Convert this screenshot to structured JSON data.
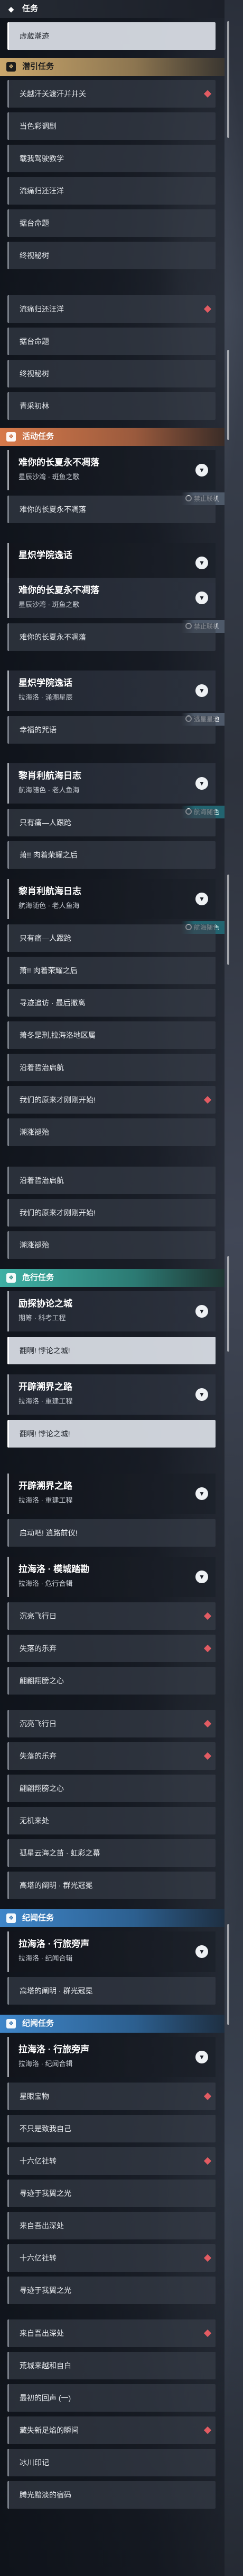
{
  "sections": {
    "task": "任务",
    "guide": "潜引任务",
    "event": "活动任务",
    "danger": "危行任务",
    "trace1": "纪闻任务",
    "trace2": "纪闻任务"
  },
  "top_items": [
    "虚葳潮迹"
  ],
  "guide_items_a": [
    "关越汗关渡汗并并关",
    "当色彩调剧",
    "载我驾驶教学",
    "流痛归还汪洋",
    "据台命题",
    "终视秘树"
  ],
  "guide_items_b": [
    "流痛归还汪洋",
    "据台命题",
    "终视秘树",
    "青采初林"
  ],
  "event": {
    "q1": {
      "title": "难你的长夏永不凋落",
      "sub": "星辰沙湾 · 斑鱼之歌",
      "items": [
        "难你的长夏永不凋落"
      ],
      "badge": "禁止联机"
    },
    "q2": {
      "title": "星炽学院逸话"
    },
    "q3": {
      "title": "难你的长夏永不凋落",
      "sub": "星辰沙湾 · 斑鱼之歌",
      "items": [
        "难你的长夏永不凋落"
      ],
      "badge": "禁止联机"
    },
    "q4": {
      "title": "星炽学院逸话",
      "sub": "拉海洛 · 涌潮星辰",
      "items": [
        "幸福的咒语"
      ],
      "badge": "逃星星池"
    },
    "q5": {
      "title": "黎肖利航海日志",
      "sub": "航海随色 · 老人鱼海",
      "items": [
        "只有痛—人跟跄",
        "萧!! 肉着荣耀之后"
      ],
      "badge": "航海随色"
    },
    "q6": {
      "title": "黎肖利航海日志",
      "sub": "航海随色 · 老人鱼海",
      "items": [
        "只有痛—人跟跄",
        "萧!! 肉着荣耀之后",
        "寻迹追访 · 最后撤离",
        "萧冬是刑,拉海洛地区属",
        "沿着哲治启航",
        "我们的原来才刚刚开始!",
        "潮涨褪殆"
      ],
      "badge": "航海随色"
    },
    "tail": [
      "沿着哲治启航",
      "我们的原来才刚刚开始!",
      "潮涨褪殆"
    ]
  },
  "danger": {
    "q1": {
      "title": "励探协论之城",
      "sub": "期筹 · 科考工程",
      "items": [
        "翻啊! 悖论之城!"
      ]
    },
    "q2": {
      "title": "开辟溯界之路",
      "sub": "拉海洛 · 重建工程",
      "items": [
        "翻啊! 悖论之城!"
      ]
    },
    "q3": {
      "title": "开辟溯界之路",
      "sub": "拉海洛 · 重建工程",
      "items": [
        "启动吧! 逍路前仪!"
      ]
    },
    "q4": {
      "title": "拉海洛 · 模城踏勘",
      "sub": "拉海洛 · 危行合辑",
      "items": [
        "沉亮飞行日",
        "失落的乐弃",
        "翩翩翔膀之心",
        "沉亮飞行日",
        "失落的乐弃",
        "翩翩翔膀之心",
        "无机来处",
        "孤星云海之苗 · 虹彩之幕",
        "高塔的阐明 · 群光冠冕"
      ]
    }
  },
  "trace1": {
    "q1": {
      "title": "拉海洛 · 行旅旁声",
      "sub": "拉海洛 · 纪闻合辑",
      "items": [
        "高塔的阐明 · 群光冠冕"
      ]
    }
  },
  "trace2": {
    "q1": {
      "title": "拉海洛 · 行旅旁声",
      "sub": "拉海洛 · 纪闻合辑",
      "items": [
        "星眼宝物",
        "不只是致我自己",
        "十六亿社转",
        "寻迹于我翼之光",
        "来自吾出深处",
        "十六亿社转",
        "寻迹于我翼之光",
        "来自吾出深处",
        "荒城来越和自白",
        "最初的回声 (一)",
        "藏失新足焰的瞬间",
        "冰川印记",
        "腾光黯淡的宿码"
      ]
    }
  },
  "colors": {
    "guide": "#caa76c",
    "event": "#d77a4b",
    "danger": "#3fb0a4",
    "trace": "#3f86c9",
    "marker": "#e25b62"
  }
}
